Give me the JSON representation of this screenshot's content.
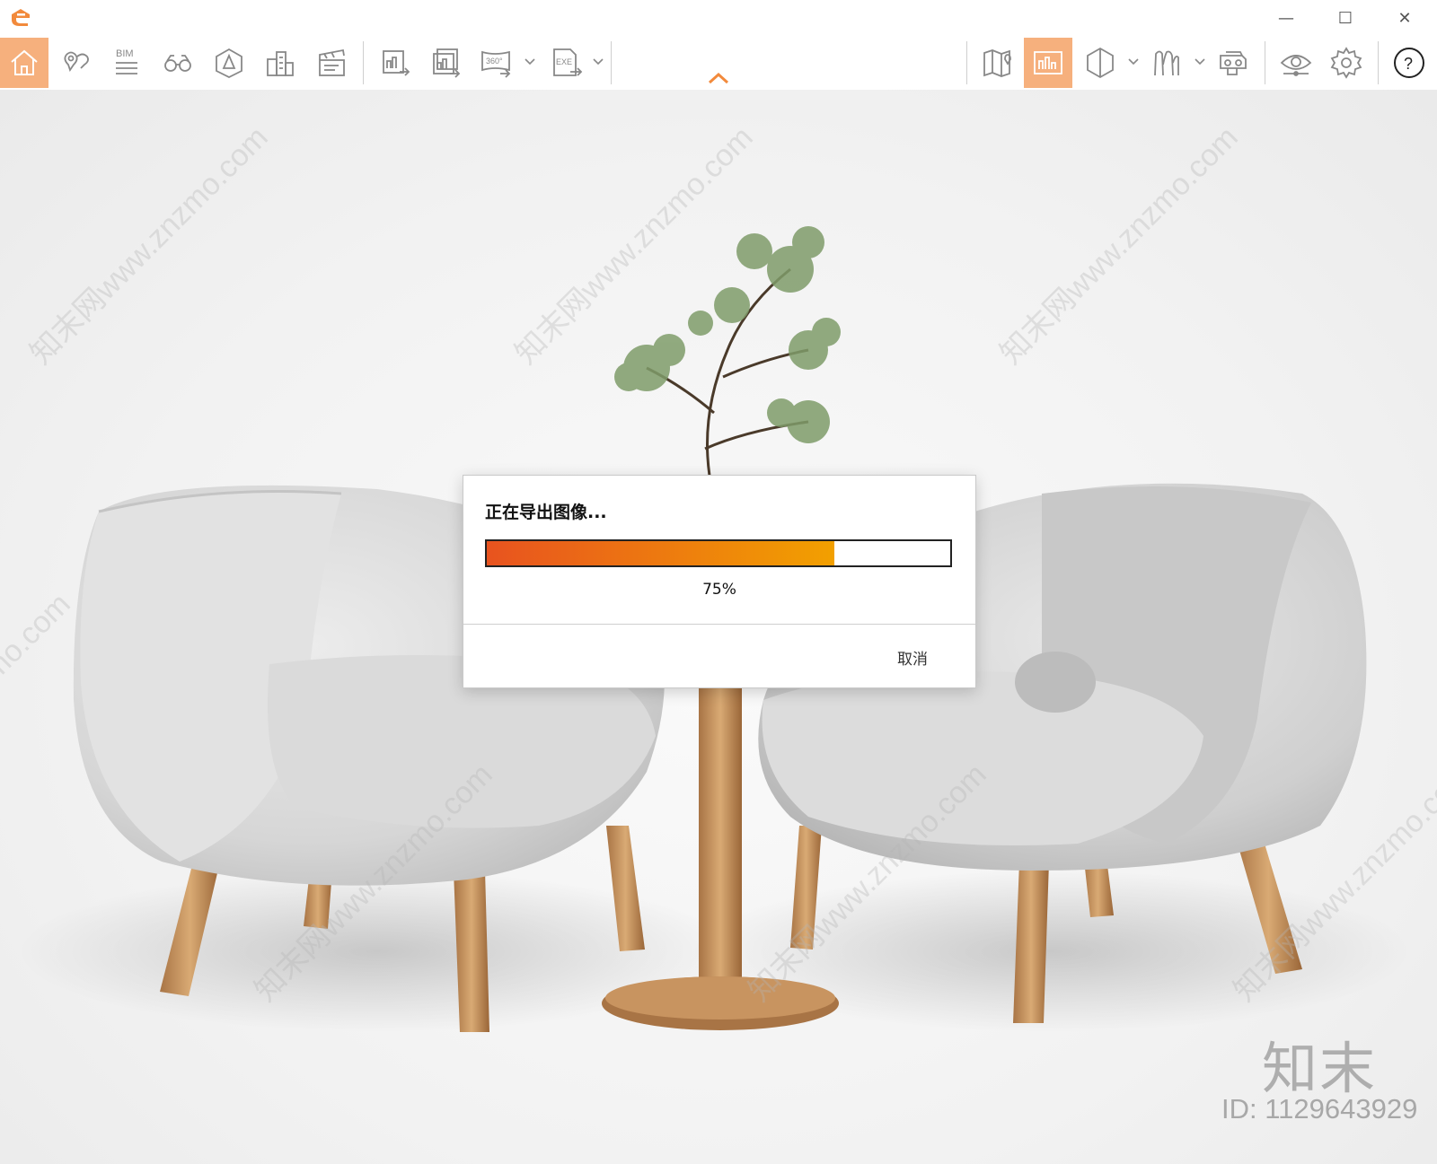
{
  "window": {
    "minimize_glyph": "—",
    "maximize_glyph": "☐",
    "close_glyph": "✕"
  },
  "toolbar": {
    "accent_color": "#f28a3c",
    "active_bg": "#f6b07d",
    "items": [
      {
        "name": "home",
        "icon": "home-icon",
        "active": true
      },
      {
        "name": "location",
        "icon": "location-pin-icon"
      },
      {
        "name": "bim",
        "icon": "bim-icon",
        "label": "BIM"
      },
      {
        "name": "binoculars",
        "icon": "binoculars-icon"
      },
      {
        "name": "perspective",
        "icon": "perspective-cube-icon"
      },
      {
        "name": "buildings",
        "icon": "buildings-icon"
      },
      {
        "name": "clapper",
        "icon": "clapperboard-icon"
      },
      {
        "name": "export-image",
        "icon": "export-image-icon"
      },
      {
        "name": "export-batch",
        "icon": "export-batch-icon"
      },
      {
        "name": "export-360",
        "icon": "export-360-icon",
        "label": "360°"
      },
      {
        "name": "export-exe",
        "icon": "export-exe-icon",
        "label": "EXE"
      },
      {
        "name": "map",
        "icon": "map-icon"
      },
      {
        "name": "gallery",
        "icon": "gallery-icon",
        "active": true
      },
      {
        "name": "section",
        "icon": "section-cube-icon"
      },
      {
        "name": "people",
        "icon": "people-icon"
      },
      {
        "name": "vr",
        "icon": "vr-headset-icon"
      },
      {
        "name": "view",
        "icon": "eye-icon"
      },
      {
        "name": "settings",
        "icon": "gear-icon"
      },
      {
        "name": "help",
        "icon": "help-icon",
        "label": "?"
      }
    ]
  },
  "dialog": {
    "title": "正在导出图像...",
    "progress_fraction": 0.75,
    "progress_text": "75%",
    "cancel_label": "取消",
    "fill_colors": [
      "#e8531f",
      "#f2a000"
    ]
  },
  "watermarks": {
    "site": "知末网www.znzmo.com",
    "brand": "知末",
    "id_text": "ID: 1129643929"
  }
}
